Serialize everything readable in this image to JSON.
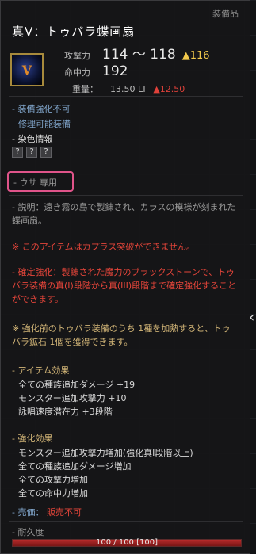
{
  "window": {
    "category": "装備品"
  },
  "item": {
    "name": "真V：トゥバラ蝶画扇",
    "icon_label": "V"
  },
  "stats": {
    "attack": {
      "label": "攻撃力",
      "value": "114 ～ 118",
      "diff": "▲116"
    },
    "accuracy": {
      "label": "命中力",
      "value": "192"
    },
    "weight": {
      "label": "重量：",
      "value": "13.50 LT",
      "diff": "▲12.50"
    }
  },
  "flags": {
    "no_enhance": "- 装備強化不可",
    "repairable": "修理可能装備",
    "dye_info": "- 染色情報"
  },
  "dye_slots": [
    "?",
    "?",
    "?"
  ],
  "restriction": "- ウサ 専用",
  "description": "- 説明：遠き霧の島で製錬され、カラスの模様が刻まれた蝶画扇。",
  "caphras_note": "※ このアイテムはカプラス突破ができません。",
  "fixed_enhance": "- 確定強化：製錬された魔力のブラックストーンで、トゥバラ装備の真(I)段階から真(III)段階まで確定強化することができます。",
  "tuvala_ore": "※ 強化前のトゥバラ装備のうち 1種を加熱すると、トゥバラ鉱石 1個を獲得できます。",
  "item_effects": {
    "header": "- アイテム効果",
    "lines": [
      "全ての種族追加ダメージ +19",
      "モンスター追加攻撃力 +10",
      "詠唱速度潜在力 +3段階"
    ]
  },
  "enhance_effects": {
    "header": "- 強化効果",
    "lines": [
      "モンスター追加攻撃力増加(強化真I段階以上)",
      "全ての種族追加ダメージ増加",
      "全ての攻撃力増加",
      "全ての命中力増加"
    ]
  },
  "sale": {
    "label": "- 売価：",
    "value": "販売不可"
  },
  "durability": {
    "label": "- 耐久度",
    "text": "100 / 100 [100]",
    "fraction": 1.0
  },
  "colors": {
    "accent_gold": "#f2c94c",
    "warning_red": "#e5453a",
    "highlight_pink": "#e0548a"
  }
}
